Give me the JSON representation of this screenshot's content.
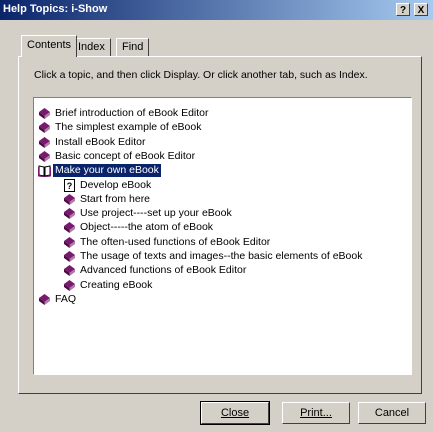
{
  "window": {
    "title": "Help Topics: i-Show",
    "help_btn": "?",
    "close_btn": "X"
  },
  "tabs": [
    {
      "label": "Contents",
      "active": true
    },
    {
      "label": "Index",
      "active": false
    },
    {
      "label": "Find",
      "active": false
    }
  ],
  "instruction": "Click a topic, and then click Display. Or click another tab, such as Index.",
  "tree": [
    {
      "label": "Brief introduction of eBook Editor",
      "icon": "book-icon",
      "level": 0
    },
    {
      "label": "The simplest example of eBook",
      "icon": "book-icon",
      "level": 0
    },
    {
      "label": "Install eBook Editor",
      "icon": "book-icon",
      "level": 0
    },
    {
      "label": "Basic concept of eBook Editor",
      "icon": "book-icon",
      "level": 0
    },
    {
      "label": "Make your own eBook",
      "icon": "open-book-icon",
      "level": 0,
      "selected": true
    },
    {
      "label": "Develop eBook",
      "icon": "help-page-icon",
      "level": 1
    },
    {
      "label": "Start from here",
      "icon": "book-icon",
      "level": 1
    },
    {
      "label": "Use project----set up your eBook",
      "icon": "book-icon",
      "level": 1
    },
    {
      "label": "Object-----the atom of eBook",
      "icon": "book-icon",
      "level": 1
    },
    {
      "label": "The often-used functions of eBook Editor",
      "icon": "book-icon",
      "level": 1
    },
    {
      "label": "The usage of texts and images--the basic elements of eBook",
      "icon": "book-icon",
      "level": 1
    },
    {
      "label": "Advanced functions of eBook Editor",
      "icon": "book-icon",
      "level": 1
    },
    {
      "label": "Creating eBook",
      "icon": "book-icon",
      "level": 1
    },
    {
      "label": "FAQ",
      "icon": "book-icon",
      "level": 0
    }
  ],
  "buttons": {
    "close": "Close",
    "print": "Print...",
    "cancel": "Cancel"
  },
  "colors": {
    "book": "#7a1a6e",
    "selection": "#0a246a",
    "titlebar": "#0a246a"
  }
}
